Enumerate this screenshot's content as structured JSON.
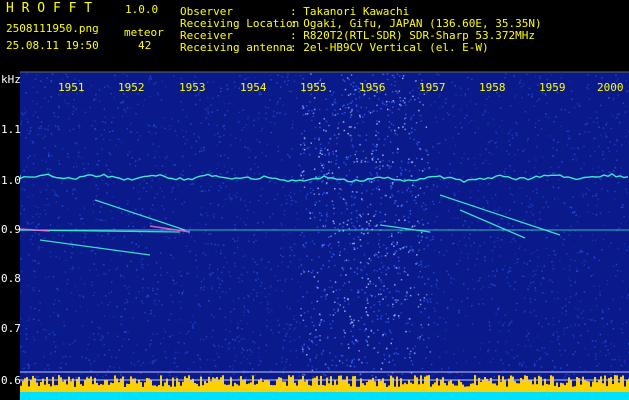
{
  "app": {
    "title": "H R O F F T",
    "version": "1.0.0"
  },
  "file": {
    "name": "2508111950.png",
    "datetime": "25.08.11 19:50"
  },
  "meteor": {
    "label": "meteor",
    "count": "42"
  },
  "info": {
    "rows": [
      {
        "label": "Observer",
        "value": ": Takanori Kawachi"
      },
      {
        "label": "Receiving Location",
        "value": ": Ogaki, Gifu, JAPAN (136.60E, 35.35N)"
      },
      {
        "label": "Receiver",
        "value": ": R820T2(RTL-SDR) SDR-Sharp 53.372MHz"
      },
      {
        "label": "Receiving antenna",
        "value": ": 2el-HB9CV Vertical (el. E-W)"
      }
    ]
  },
  "axis": {
    "y_unit": "kHz",
    "x_ticks": [
      "1951",
      "1952",
      "1953",
      "1954",
      "1955",
      "1956",
      "1957",
      "1958",
      "1959",
      "2000"
    ],
    "y_ticks": [
      "1.1",
      "1.0",
      "0.9",
      "0.8",
      "0.7",
      "0.6"
    ]
  },
  "colors": {
    "background": "#0a1a8a",
    "noise_bright": "#2a5cff",
    "signal": "#40ffd0",
    "meteor": "#ff6ad0",
    "baseline_yellow": "#ffd000",
    "baseline_cyan": "#00e0ff"
  }
}
